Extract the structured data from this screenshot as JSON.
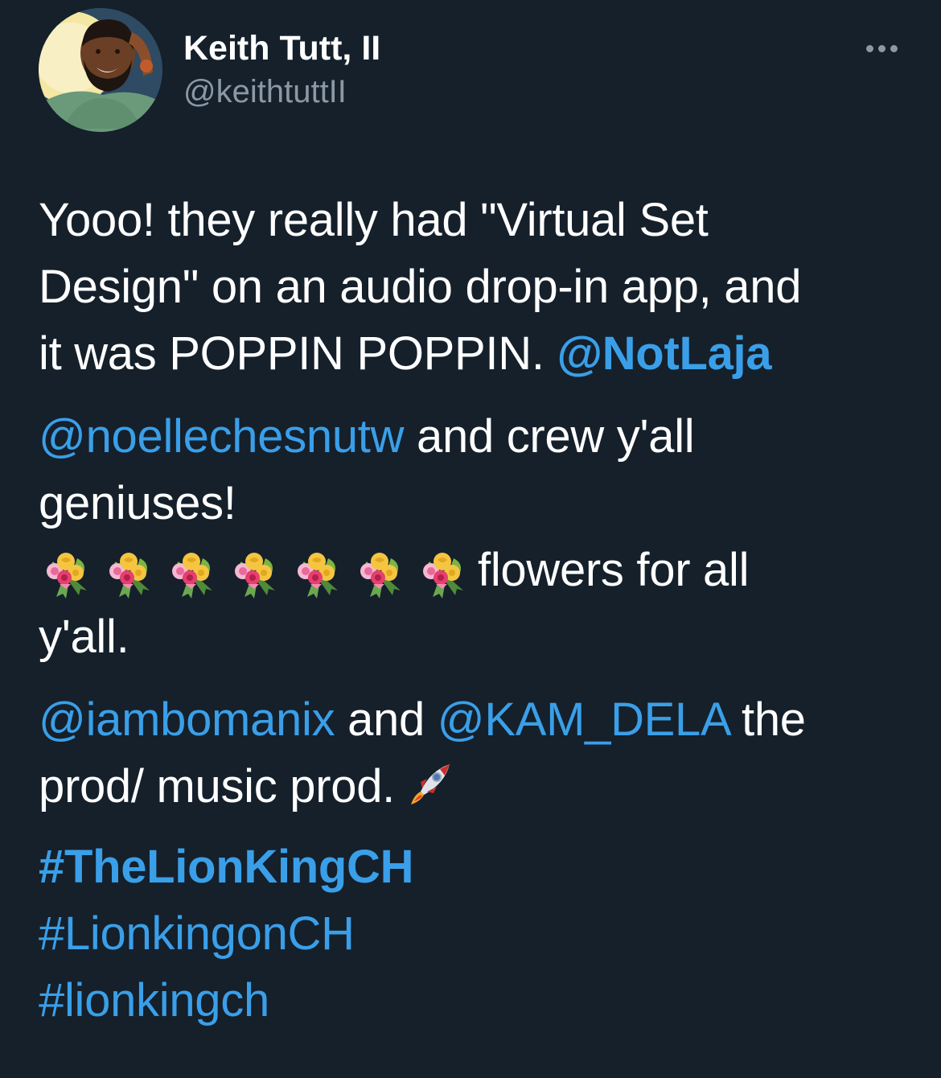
{
  "author": {
    "name": "Keith Tutt, II",
    "handle": "@keithtuttII"
  },
  "tweet": {
    "line1a": "Yooo! they really had \"Virtual Set",
    "line1b": "Design\" on an audio drop-in app, and",
    "line1c": "it was POPPIN POPPIN. ",
    "mention_notlaja": "@NotLaja",
    "mention_noelle": "@noellechesnutw",
    "text_and_crew": " and crew y'all",
    "text_geniuses": "geniuses!",
    "text_flowers": "flowers for all",
    "text_yall": "y'all.",
    "mention_iambomanix": "@iambomanix",
    "text_and": " and ",
    "mention_kamdela": "@KAM_DELA",
    "text_the": " the",
    "text_prod": "prod/ music prod.",
    "hashtag1": "#TheLionKingCH",
    "hashtag2": "#LionkingonCH",
    "hashtag3": "#lionkingch"
  },
  "icons": {
    "more": "more-icon",
    "bouquet": "bouquet-emoji",
    "rocket": "rocket-emoji"
  },
  "bouquet_count": 7,
  "colors": {
    "background": "#15202b",
    "link": "#1d9bf0",
    "secondary_text": "#8b98a5"
  }
}
